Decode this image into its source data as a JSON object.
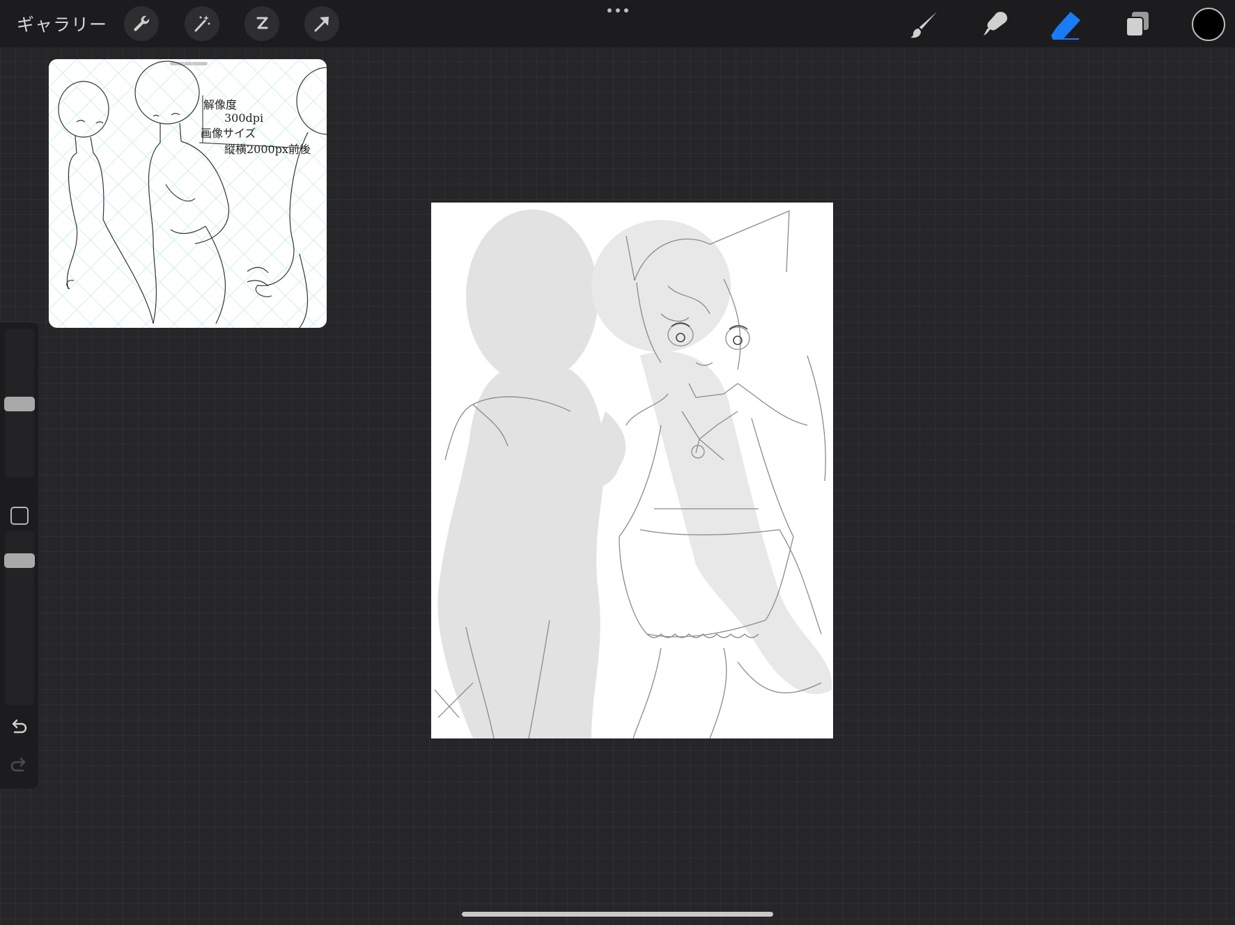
{
  "toolbar": {
    "gallery_label": "ギャラリー",
    "left_tools": [
      "wrench-icon",
      "magic-wand-icon",
      "selection-icon",
      "transform-arrow-icon"
    ],
    "right_tools": [
      "brush-icon",
      "smudge-icon",
      "eraser-icon",
      "layers-icon"
    ],
    "active_tool": "eraser",
    "active_color": "#000000",
    "accent": "#1a7cf5"
  },
  "reference": {
    "line1": "解像度",
    "line2": "300dpi",
    "line3": "画像サイズ",
    "line4": "縦横2000px前後"
  },
  "sidebar": {
    "brush_size_level": 0.5,
    "opacity_level": 0.08
  }
}
